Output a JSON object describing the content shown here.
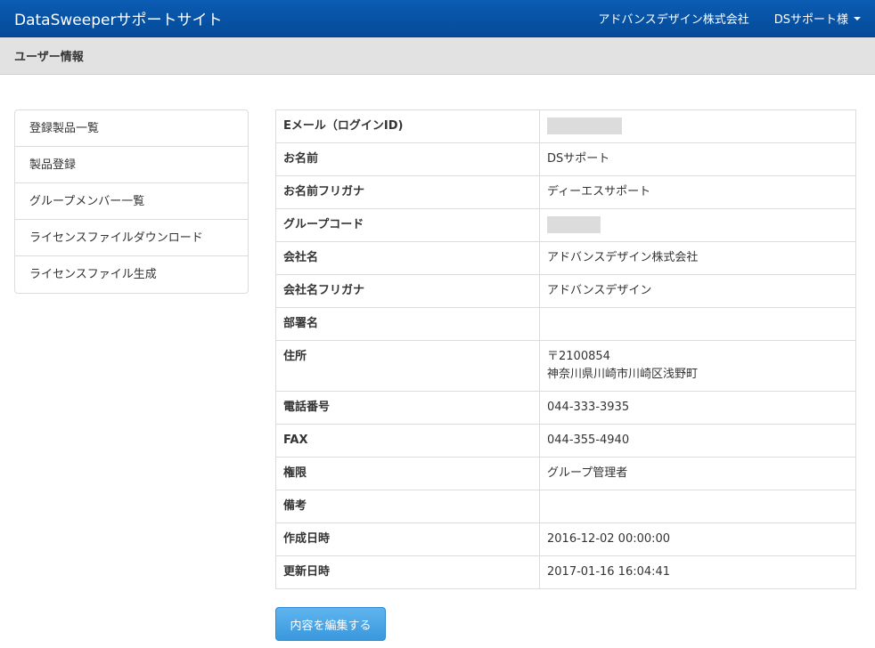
{
  "navbar": {
    "brand": "DataSweeperサポートサイト",
    "company": "アドバンスデザイン株式会社",
    "user": "DSサポート様"
  },
  "page_header": {
    "title": "ユーザー情報"
  },
  "sidebar": {
    "items": [
      {
        "label": "登録製品一覧"
      },
      {
        "label": "製品登録"
      },
      {
        "label": "グループメンバー一覧"
      },
      {
        "label": "ライセンスファイルダウンロード"
      },
      {
        "label": "ライセンスファイル生成"
      }
    ]
  },
  "detail": {
    "rows": [
      {
        "label": "Eメール（ログインID)",
        "value": ""
      },
      {
        "label": "お名前",
        "value": "DSサポート"
      },
      {
        "label": "お名前フリガナ",
        "value": "ディーエスサポート"
      },
      {
        "label": "グループコード",
        "value": ""
      },
      {
        "label": "会社名",
        "value": "アドバンスデザイン株式会社"
      },
      {
        "label": "会社名フリガナ",
        "value": "アドバンスデザイン"
      },
      {
        "label": "部署名",
        "value": ""
      },
      {
        "label": "住所",
        "value": "〒2100854",
        "value2": "神奈川県川崎市川崎区浅野町"
      },
      {
        "label": "電話番号",
        "value": "044-333-3935"
      },
      {
        "label": "FAX",
        "value": "044-355-4940"
      },
      {
        "label": "権限",
        "value": "グループ管理者"
      },
      {
        "label": "備考",
        "value": ""
      },
      {
        "label": "作成日時",
        "value": "2016-12-02 00:00:00"
      },
      {
        "label": "更新日時",
        "value": "2017-01-16 16:04:41"
      }
    ]
  },
  "actions": {
    "edit_label": "内容を編集する"
  }
}
